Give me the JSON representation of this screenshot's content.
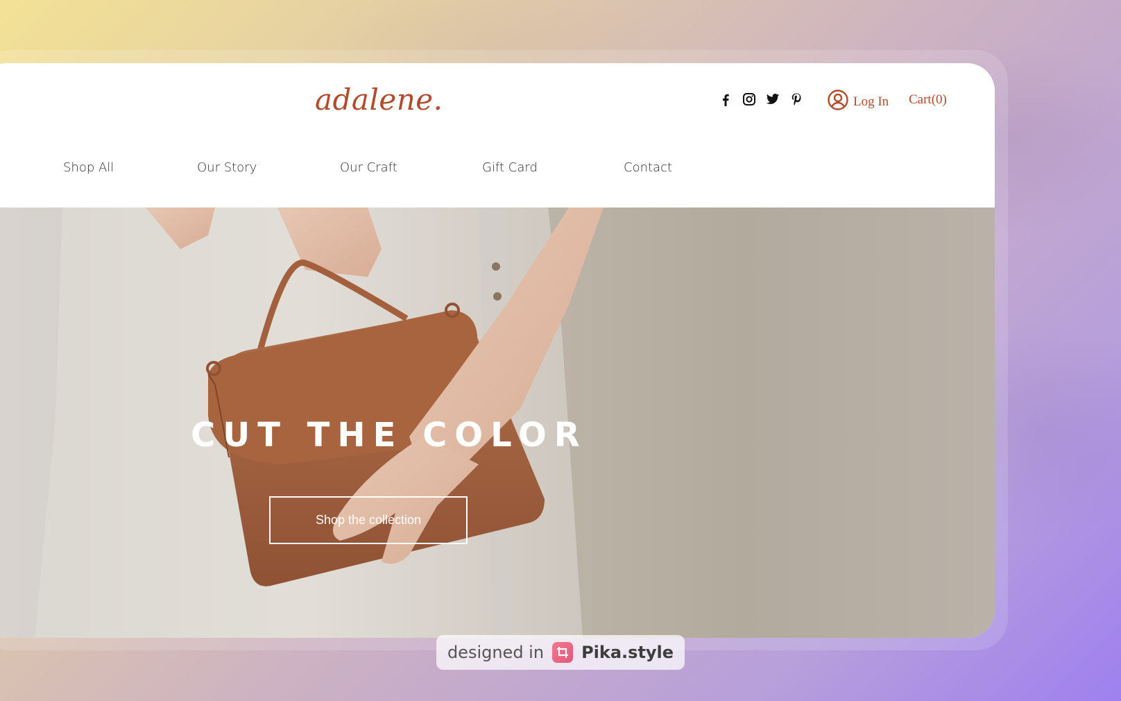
{
  "brand": {
    "logo": "adalene.",
    "accent_color": "#b24a2b"
  },
  "header": {
    "socials": [
      {
        "icon": "facebook-icon"
      },
      {
        "icon": "instagram-icon"
      },
      {
        "icon": "twitter-icon"
      },
      {
        "icon": "pinterest-icon"
      }
    ],
    "login_label": "Log In",
    "cart_label": "Cart(0)"
  },
  "nav": {
    "items": [
      {
        "label": "Shop All"
      },
      {
        "label": "Our Story"
      },
      {
        "label": "Our Craft"
      },
      {
        "label": "Gift Card"
      },
      {
        "label": "Contact"
      }
    ]
  },
  "hero": {
    "title": "CUT THE COLOR",
    "button_label": "Shop the collection"
  },
  "watermark": {
    "prefix": "designed in",
    "brand": "Pika.style"
  }
}
